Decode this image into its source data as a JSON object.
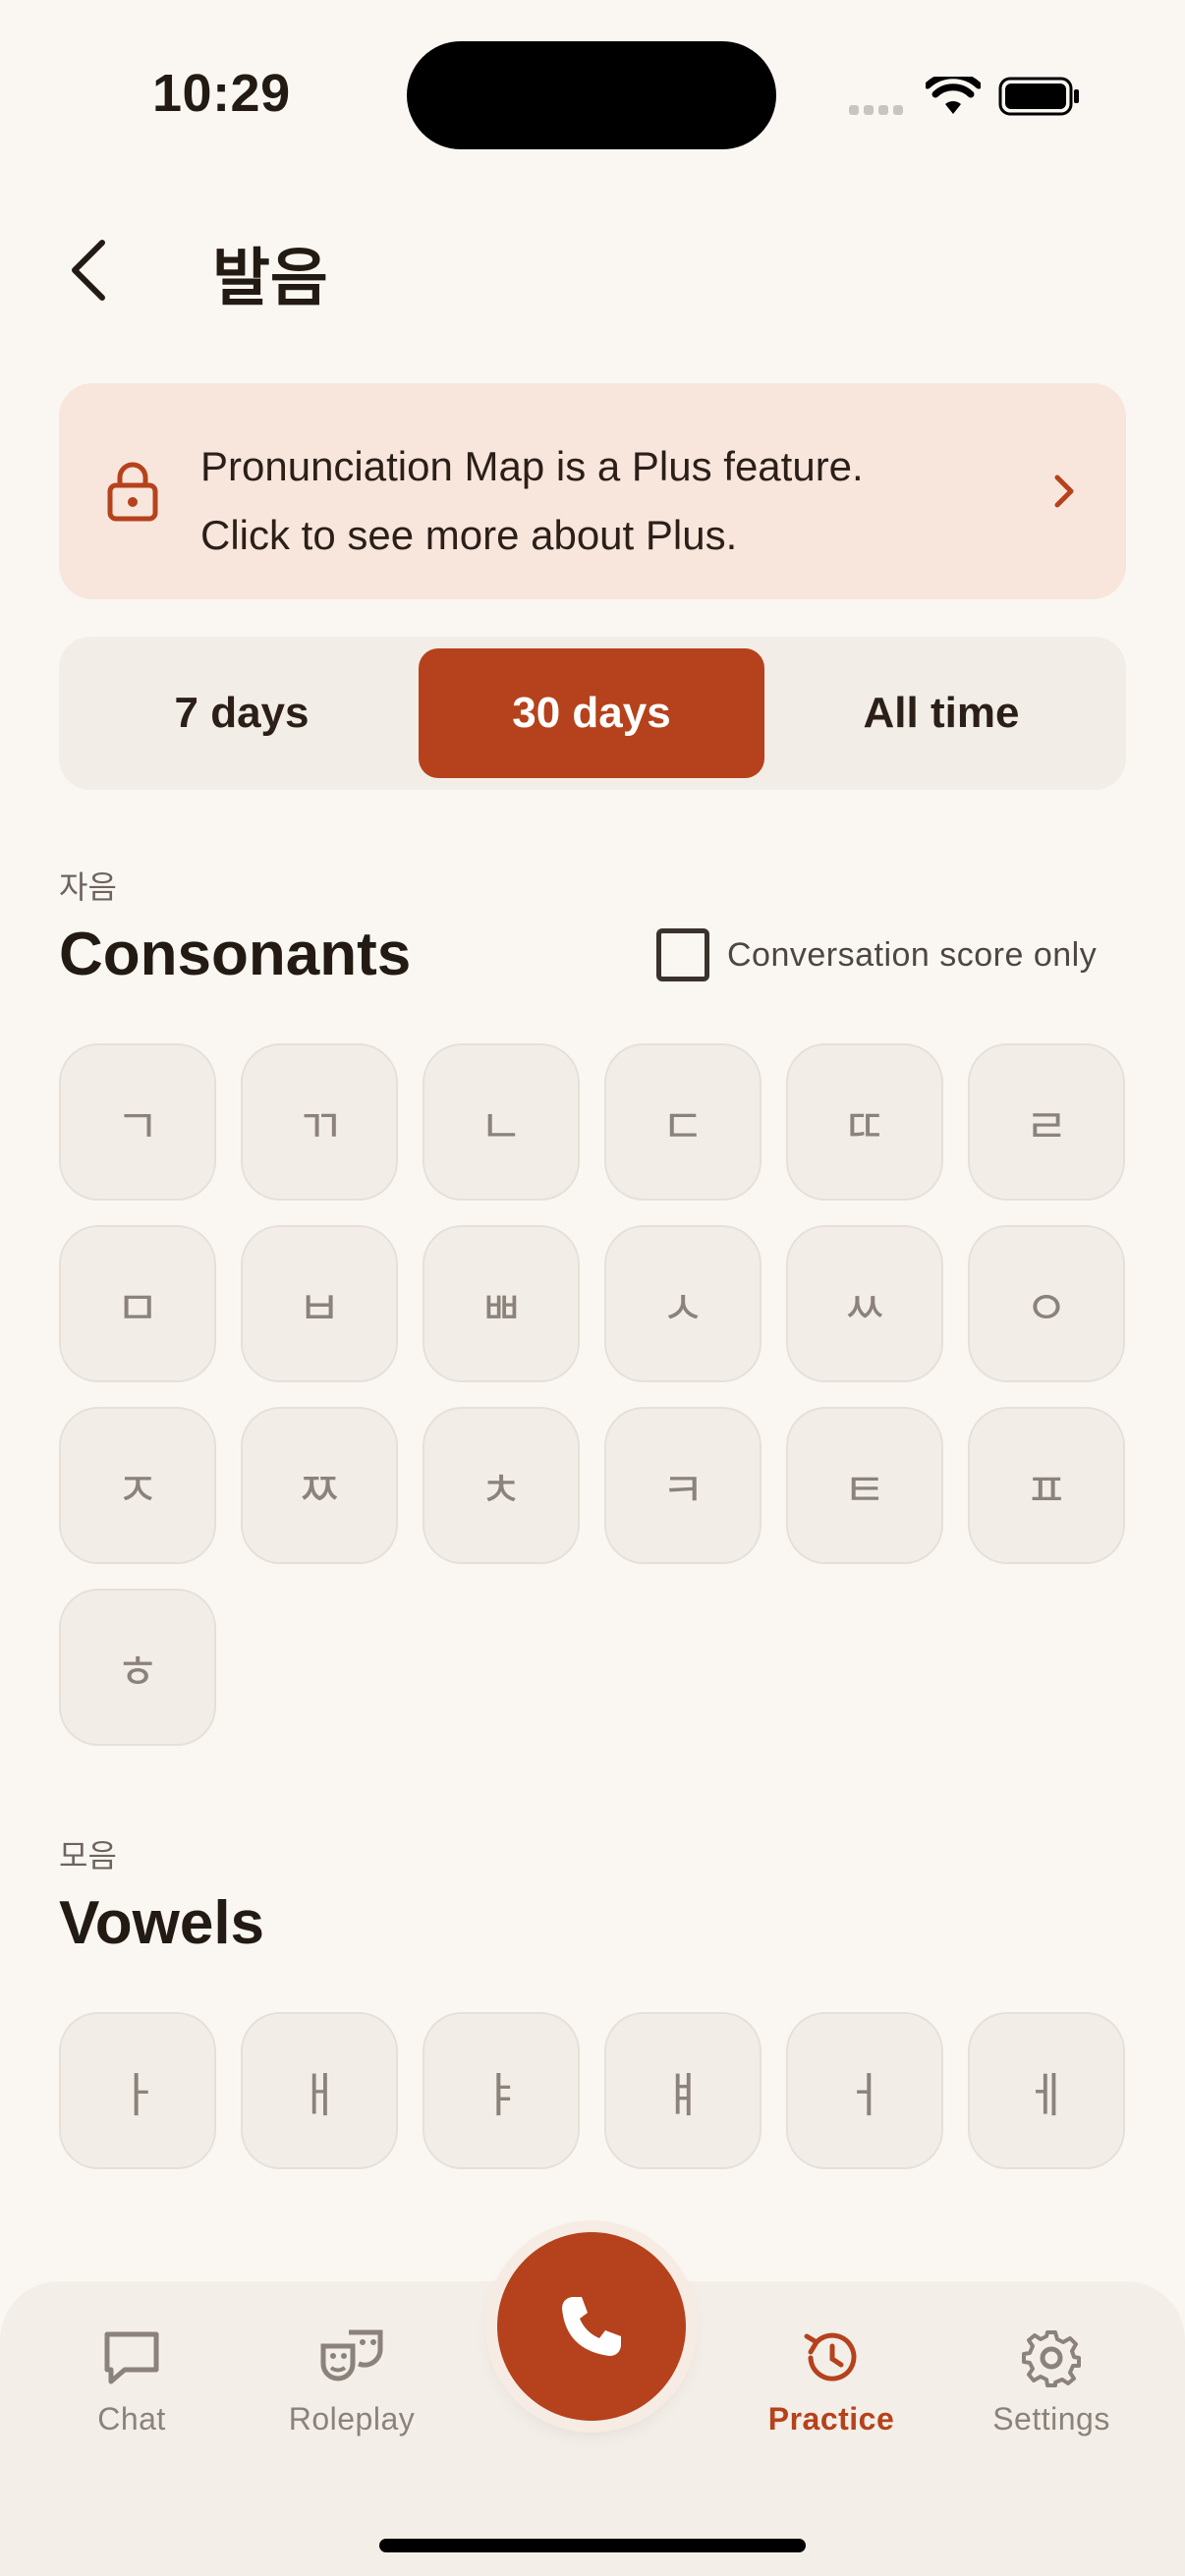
{
  "status": {
    "time": "10:29"
  },
  "header": {
    "title": "발음"
  },
  "banner": {
    "line1": "Pronunciation Map is a Plus feature.",
    "line2": "Click to see more about Plus."
  },
  "segmented": {
    "options": [
      "7 days",
      "30 days",
      "All time"
    ],
    "selected": "30 days"
  },
  "consonants": {
    "kicker": "자음",
    "title": "Consonants",
    "checkbox_label": "Conversation score only",
    "items": [
      "ㄱ",
      "ㄲ",
      "ㄴ",
      "ㄷ",
      "ㄸ",
      "ㄹ",
      "ㅁ",
      "ㅂ",
      "ㅃ",
      "ㅅ",
      "ㅆ",
      "ㅇ",
      "ㅈ",
      "ㅉ",
      "ㅊ",
      "ㅋ",
      "ㅌ",
      "ㅍ",
      "ㅎ"
    ]
  },
  "vowels": {
    "kicker": "모음",
    "title": "Vowels",
    "items": [
      "ㅏ",
      "ㅐ",
      "ㅑ",
      "ㅒ",
      "ㅓ",
      "ㅔ"
    ]
  },
  "tabbar": {
    "items": [
      {
        "label": "Chat"
      },
      {
        "label": "Roleplay"
      },
      {
        "label": "Practice"
      },
      {
        "label": "Settings"
      }
    ]
  },
  "colors": {
    "accent": "#b5421c",
    "background": "#faf7f2",
    "banner": "#f8e6dd"
  }
}
